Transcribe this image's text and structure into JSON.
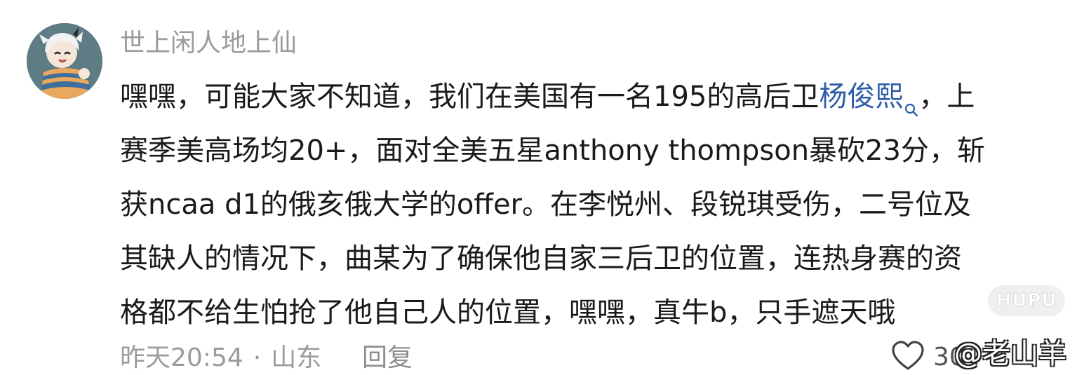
{
  "comment": {
    "username": "世上闲人地上仙",
    "content_lines": {
      "line1_a": "嘿嘿，可能大家不知道，我们在美国有一名195的高后卫",
      "line1_mention": "杨俊熙",
      "line1_b": "，上",
      "line2": "赛季美高场均20+，面对全美五星anthony thompson暴砍23分，斩",
      "line3": "获ncaa d1的俄亥俄大学的offer。在李悦州、段锐琪受伤，二号位及",
      "line4": "其缺人的情况下，曲某为了确保他自家三后卫的位置，连热身赛的资",
      "line5": "格都不给生怕抢了他自己人的位置，嘿嘿，真牛b，只手遮天哦"
    },
    "meta": {
      "time": "昨天20:54",
      "separator": "·",
      "location": "山东",
      "reply_label": "回复"
    },
    "likes": {
      "count": "30"
    }
  },
  "watermarks": {
    "brand": "HUPU",
    "author": "@老山羊"
  },
  "icons": {
    "avatar": "avatar-illustration",
    "search": "search-icon",
    "like": "heart-icon"
  },
  "colors": {
    "username": "#9b9b9b",
    "text": "#1a1a1a",
    "mention": "#2e5ea8",
    "meta": "#9b9b9b"
  }
}
